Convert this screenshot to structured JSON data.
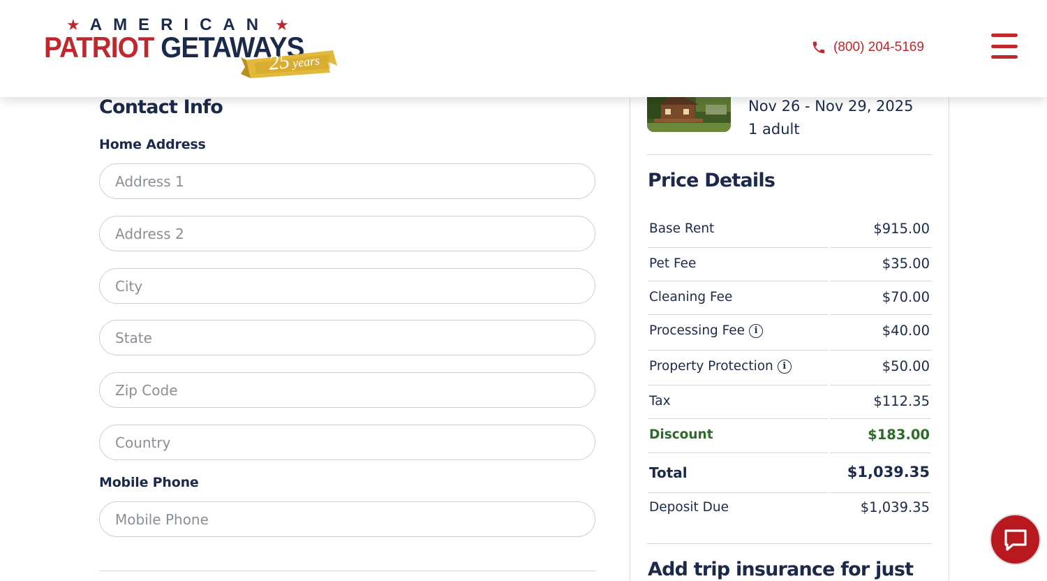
{
  "header": {
    "logo": {
      "top_line": "AMERICAN",
      "word_red": "PATRIOT",
      "word_blue": "GETAWAYS",
      "badge_number": "25",
      "badge_word": "years"
    },
    "phone": "(800) 204-5169",
    "menu_icon": "hamburger-menu-icon"
  },
  "contact": {
    "title": "Contact Info",
    "home_address_label": "Home Address",
    "fields": {
      "address1_placeholder": "Address 1",
      "address2_placeholder": "Address 2",
      "city_placeholder": "City",
      "state_placeholder": "State",
      "zip_placeholder": "Zip Code",
      "country_placeholder": "Country"
    },
    "mobile_label": "Mobile Phone",
    "mobile_placeholder": "Mobile Phone"
  },
  "summary": {
    "dates": "Nov 26 - Nov 29, 2025",
    "guests": "1 adult",
    "price_title": "Price Details",
    "rows": [
      {
        "label": "Base Rent",
        "amount": "$915.00"
      },
      {
        "label": "Pet Fee",
        "amount": "$35.00"
      },
      {
        "label": "Cleaning Fee",
        "amount": "$70.00"
      },
      {
        "label": "Processing Fee",
        "amount": "$40.00",
        "info": true
      },
      {
        "label": "Property Protection",
        "amount": "$50.00",
        "info": true
      },
      {
        "label": "Tax",
        "amount": "$112.35"
      },
      {
        "label": "Discount",
        "amount": "$183.00"
      },
      {
        "label": "Total",
        "amount": "$1,039.35"
      },
      {
        "label": "Deposit Due",
        "amount": "$1,039.35"
      }
    ],
    "insurance_title": "Add trip insurance for just"
  },
  "colors": {
    "brand_red": "#c0282d",
    "brand_navy": "#1b2a4a",
    "discount_green": "#2e6b2a",
    "chat_red": "#b8191f"
  }
}
